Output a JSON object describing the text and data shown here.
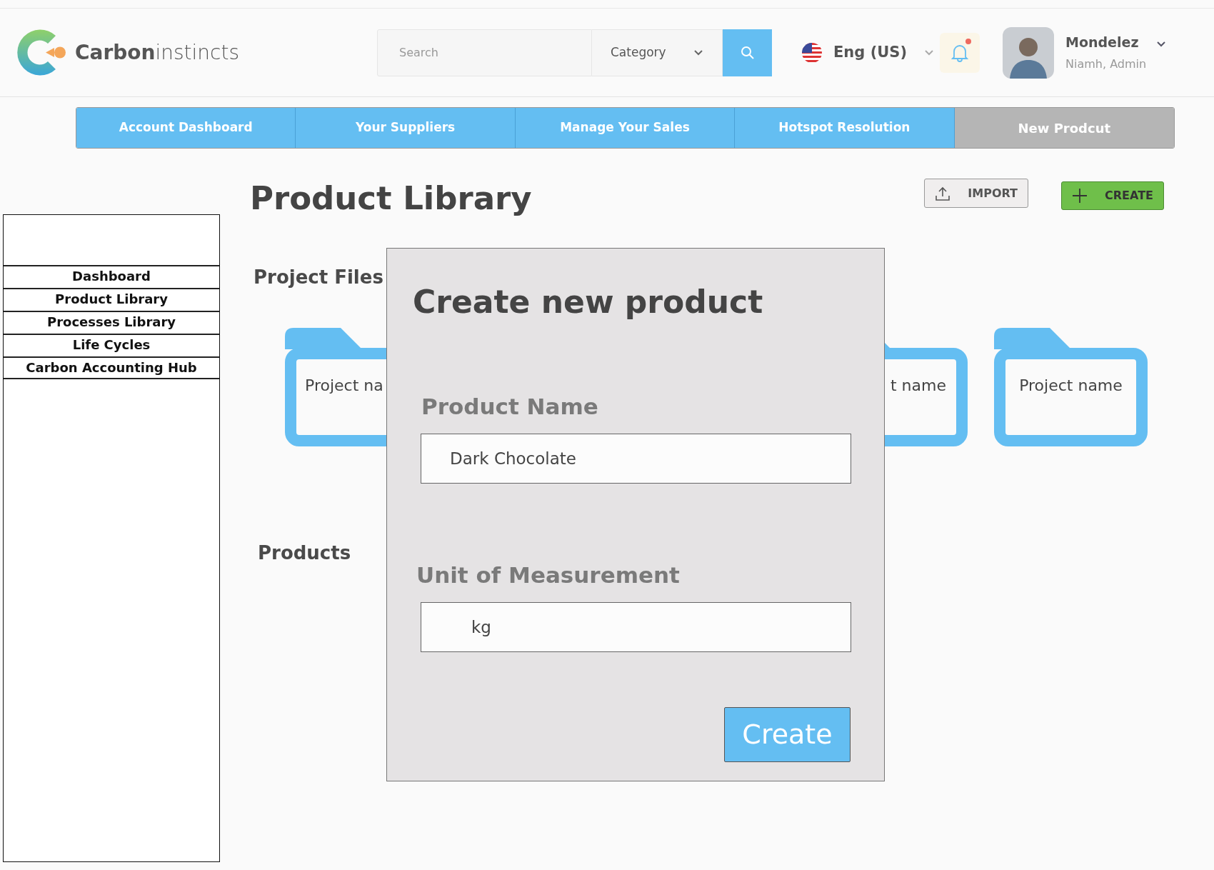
{
  "header": {
    "logo": {
      "text": "**Carbon**instincts"
    },
    "search": {
      "placeholder": "Search"
    },
    "category": {
      "label": "Category"
    },
    "language": {
      "label": "Eng (US)"
    },
    "notifications": {
      "unread": true
    },
    "user": {
      "name": "Mondelez",
      "subtitle": "Niamh, Admin"
    }
  },
  "nav_tabs": [
    {
      "label": "Account Dashboard",
      "disabled": false
    },
    {
      "label": "Your Suppliers",
      "disabled": false
    },
    {
      "label": "Manage Your Sales",
      "disabled": false
    },
    {
      "label": "Hotspot Resolution",
      "disabled": false
    },
    {
      "label": "New Prodcut",
      "disabled": true
    }
  ],
  "sidebar": {
    "items": [
      "Dashboard",
      "Product Library",
      "Processes Library",
      "Life Cycles",
      "Carbon Accounting Hub"
    ]
  },
  "page": {
    "title": "Product Library",
    "buttons": [
      {
        "kind": "import",
        "label": "IMPORT"
      },
      {
        "kind": "create",
        "label": "CREATE"
      }
    ]
  },
  "project_files": {
    "title": "Project Files",
    "folders": [
      {
        "label": "Project na"
      },
      {
        "label": "t name"
      },
      {
        "label": "Project name"
      }
    ]
  },
  "products": {
    "title": "Products"
  },
  "modal": {
    "title": "Create new product",
    "fields": [
      {
        "label": "Product Name",
        "value": "Dark Chocolate"
      },
      {
        "label": "Unit of Measurement",
        "value": "kg"
      }
    ],
    "submit": "Create"
  }
}
